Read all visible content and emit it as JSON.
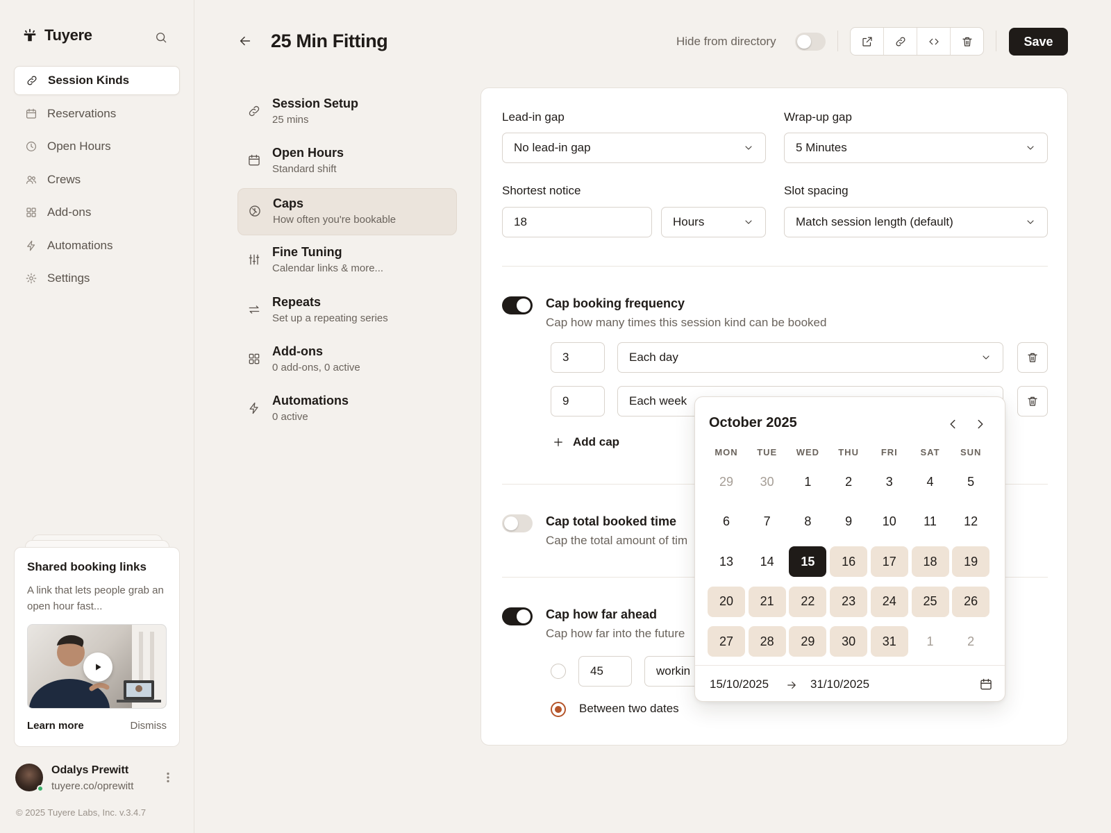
{
  "app": {
    "name": "Tuyere"
  },
  "nav": [
    {
      "label": "Session Kinds",
      "icon": "link-icon",
      "active": true
    },
    {
      "label": "Reservations",
      "icon": "calendar-icon"
    },
    {
      "label": "Open Hours",
      "icon": "clock-icon"
    },
    {
      "label": "Crews",
      "icon": "users-icon"
    },
    {
      "label": "Add-ons",
      "icon": "grid-icon"
    },
    {
      "label": "Automations",
      "icon": "bolt-icon"
    },
    {
      "label": "Settings",
      "icon": "gear-icon"
    }
  ],
  "promo": {
    "title": "Shared booking links",
    "description": "A link that lets people grab an open hour fast...",
    "learn_more": "Learn more",
    "dismiss": "Dismiss"
  },
  "user": {
    "name": "Odalys Prewitt",
    "url": "tuyere.co/oprewitt",
    "status": "online"
  },
  "footer": {
    "copyright": "© 2025 Tuyere Labs, Inc. v.3.4.7"
  },
  "header": {
    "title": "25 Min Fitting",
    "hide_label": "Hide from directory",
    "hide_enabled": false,
    "actions": [
      "external-link-icon",
      "link-icon",
      "code-icon",
      "trash-icon"
    ],
    "save_label": "Save"
  },
  "steps": [
    {
      "title": "Session Setup",
      "subtitle": "25 mins",
      "icon": "link-icon"
    },
    {
      "title": "Open Hours",
      "subtitle": "Standard shift",
      "icon": "calendar-icon"
    },
    {
      "title": "Caps",
      "subtitle": "How often you're bookable",
      "icon": "clock-icon",
      "active": true
    },
    {
      "title": "Fine Tuning",
      "subtitle": "Calendar links & more...",
      "icon": "sliders-icon"
    },
    {
      "title": "Repeats",
      "subtitle": "Set up a repeating series",
      "icon": "repeat-icon"
    },
    {
      "title": "Add-ons",
      "subtitle": "0 add-ons, 0 active",
      "icon": "grid-icon"
    },
    {
      "title": "Automations",
      "subtitle": "0 active",
      "icon": "bolt-icon"
    }
  ],
  "form": {
    "lead_in": {
      "label": "Lead-in gap",
      "value": "No lead-in gap"
    },
    "wrap_up": {
      "label": "Wrap-up gap",
      "value": "5 Minutes"
    },
    "notice": {
      "label": "Shortest notice",
      "value": "18",
      "unit": "Hours"
    },
    "spacing": {
      "label": "Slot spacing",
      "value": "Match session length (default)"
    },
    "freq": {
      "title": "Cap booking frequency",
      "subtitle": "Cap how many times this session kind can be booked",
      "enabled": true,
      "rows": [
        {
          "count": "3",
          "period": "Each day"
        },
        {
          "count": "9",
          "period": "Each week"
        }
      ],
      "add_label": "Add cap"
    },
    "total": {
      "title": "Cap total booked time",
      "subtitle": "Cap the total amount of tim",
      "enabled": false
    },
    "ahead": {
      "title": "Cap how far ahead",
      "subtitle": "Cap how far into the future",
      "enabled": true,
      "days_value": "45",
      "days_unit": "workin",
      "between_label": "Between two dates",
      "selected_option": "between"
    }
  },
  "calendar": {
    "month": "October 2025",
    "weekdays": [
      "MON",
      "TUE",
      "WED",
      "THU",
      "FRI",
      "SAT",
      "SUN"
    ],
    "days": [
      [
        "29",
        "30",
        "1",
        "2",
        "3",
        "4",
        "5"
      ],
      [
        "6",
        "7",
        "8",
        "9",
        "10",
        "11",
        "12"
      ],
      [
        "13",
        "14",
        "15",
        "16",
        "17",
        "18",
        "19"
      ],
      [
        "20",
        "21",
        "22",
        "23",
        "24",
        "25",
        "26"
      ],
      [
        "27",
        "28",
        "29",
        "30",
        "31",
        "1",
        "2"
      ]
    ],
    "outside_month": [
      [
        0,
        0
      ],
      [
        0,
        1
      ],
      [
        4,
        5
      ],
      [
        4,
        6
      ]
    ],
    "selected": [
      2,
      2
    ],
    "range_start": [
      2,
      3
    ],
    "range_end": [
      4,
      4
    ],
    "from": "15/10/2025",
    "to": "31/10/2025"
  }
}
